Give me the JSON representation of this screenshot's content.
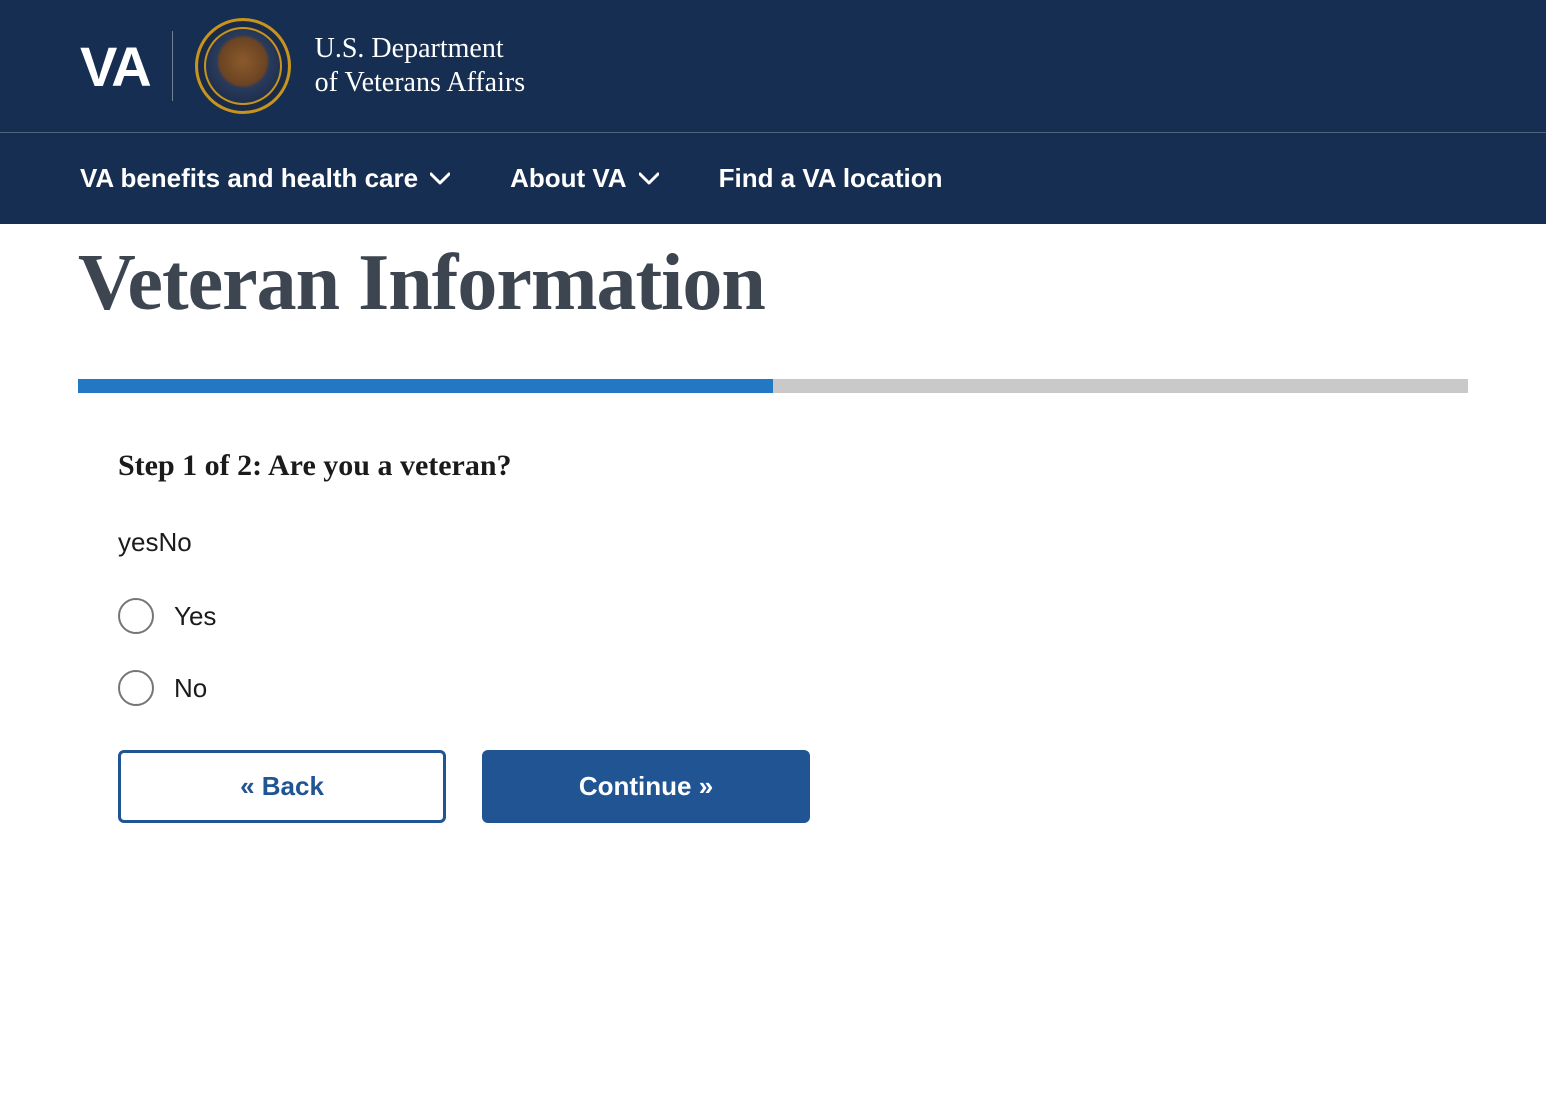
{
  "header": {
    "logo_text": "VA",
    "dept_line1": "U.S. Department",
    "dept_line2": "of Veterans Affairs"
  },
  "nav": {
    "item1": "VA benefits and health care",
    "item2": "About VA",
    "item3": "Find a VA location"
  },
  "main": {
    "title": "Veteran Information",
    "step_heading": "Step 1 of 2: Are you a veteran?",
    "legend": "yesNo",
    "options": {
      "yes": "Yes",
      "no": "No"
    },
    "buttons": {
      "back": "« Back",
      "continue": "Continue »"
    }
  }
}
